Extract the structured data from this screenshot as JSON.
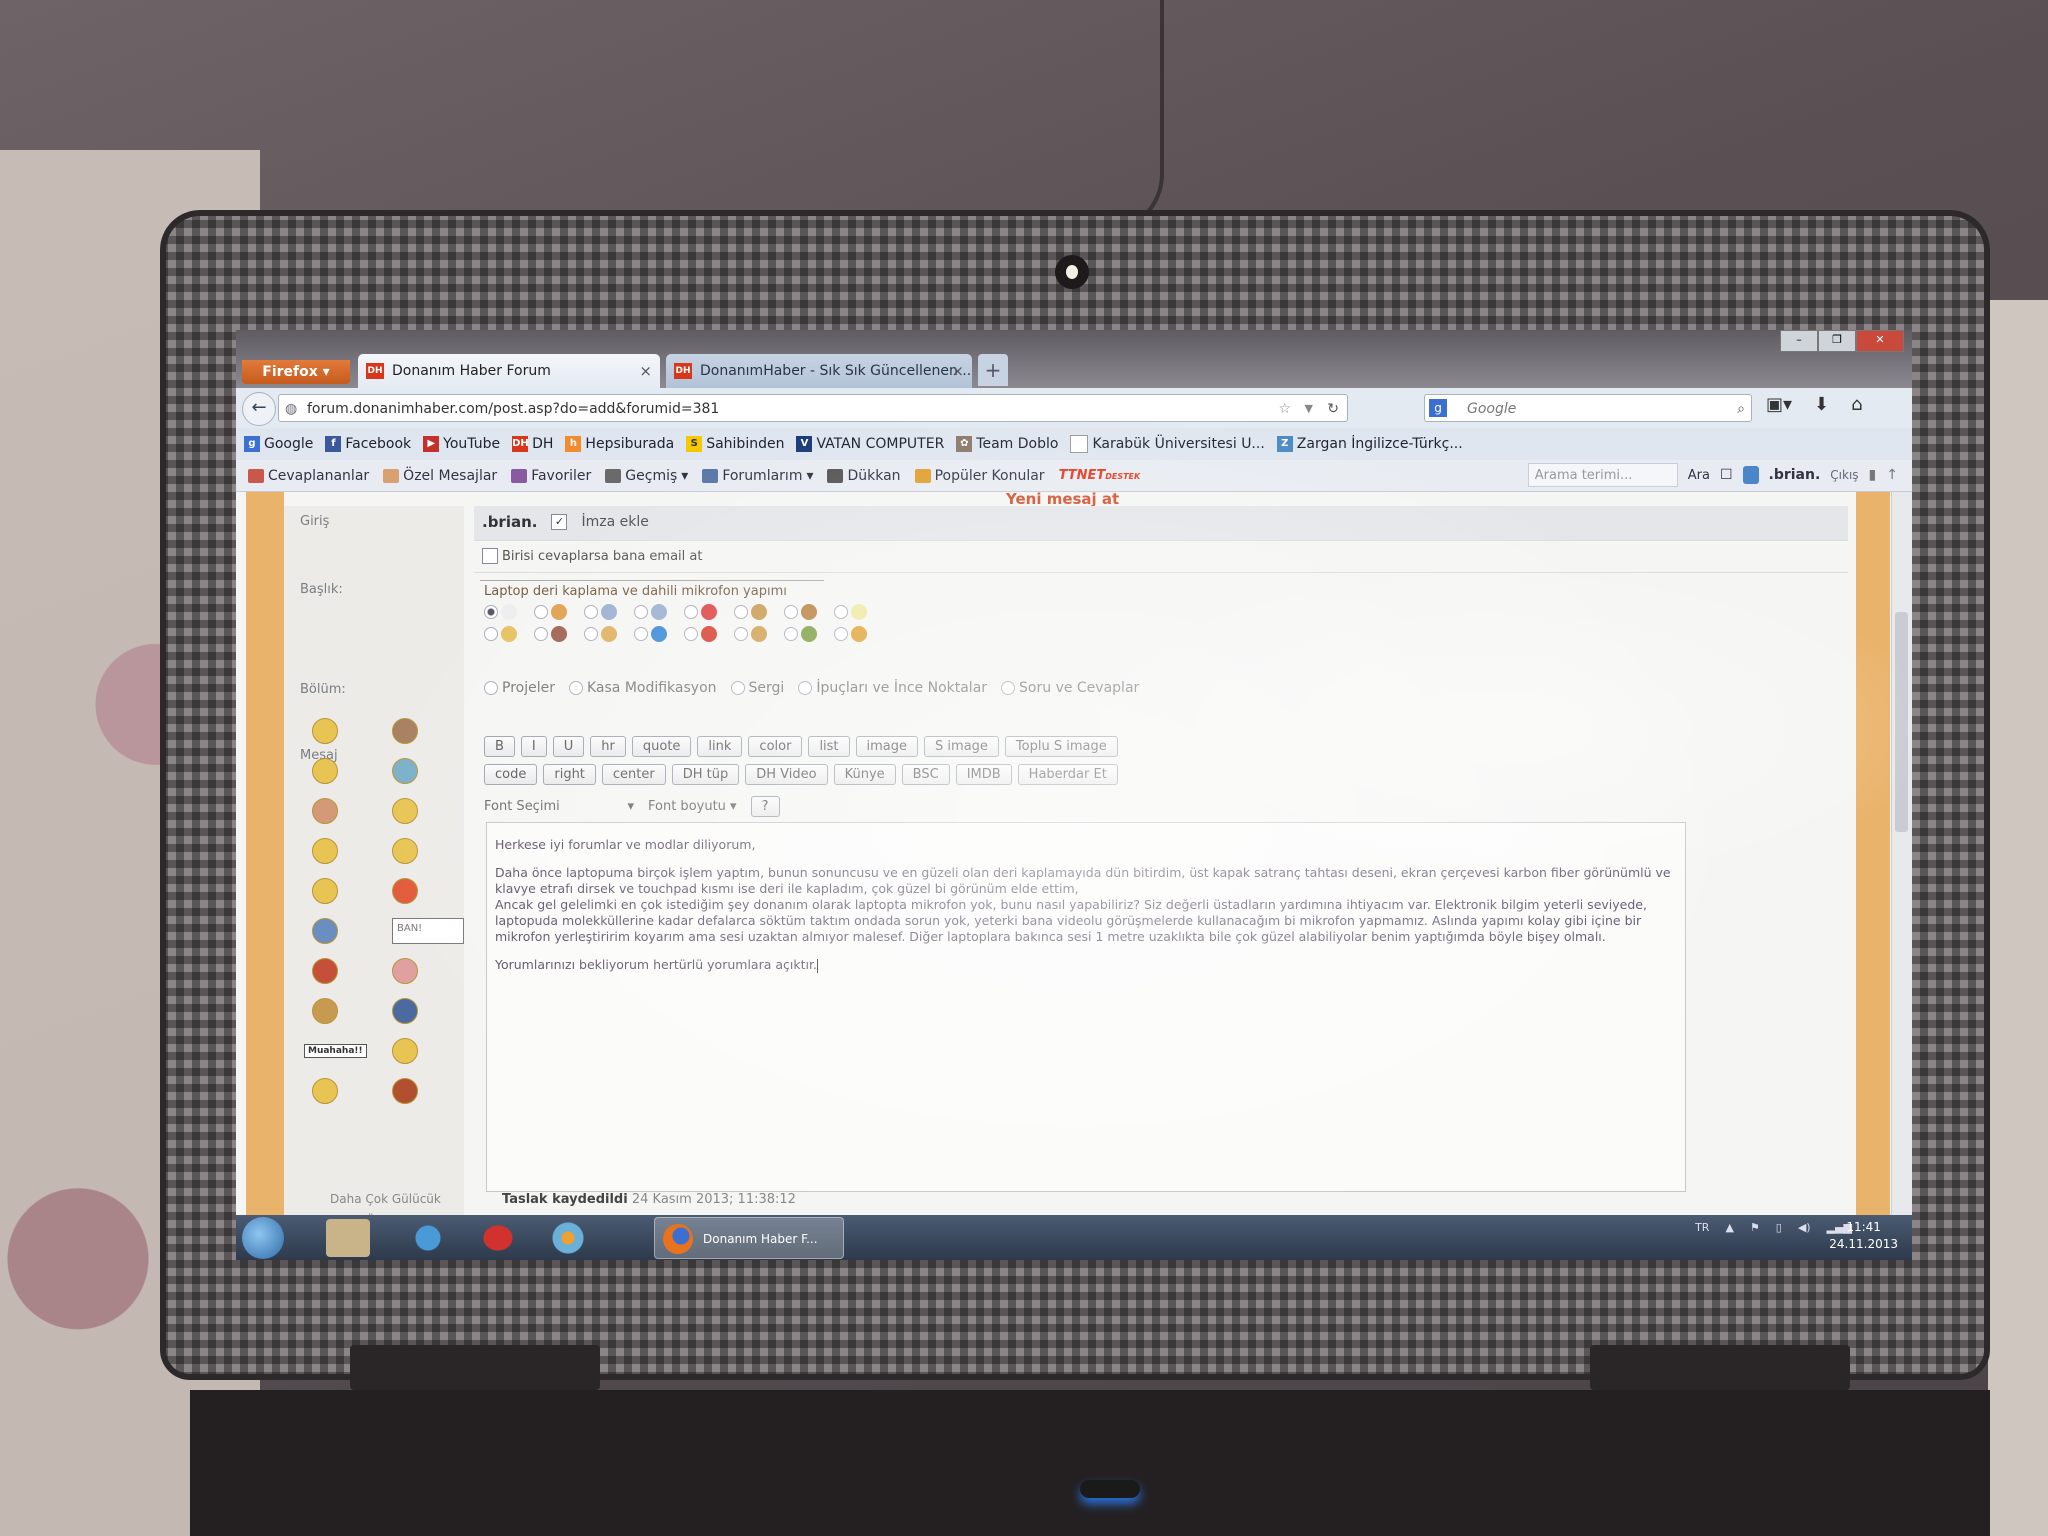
{
  "browser": {
    "menu_button": "Firefox",
    "tabs": [
      {
        "label": "Donanım Haber Forum",
        "favicon": "DH",
        "active": true
      },
      {
        "label": "DonanımHaber - Sık Sık Güncellenen ...",
        "favicon": "DH",
        "active": false
      }
    ],
    "new_tab": "+",
    "url": "forum.donanimhaber.com/post.asp?do=add&forumid=381",
    "search_engine": "Google",
    "search_placeholder": "Google"
  },
  "bookmarks": [
    {
      "label": "Google",
      "icon": "google-icon",
      "color": "#3b6fd1",
      "glyph": "g"
    },
    {
      "label": "Facebook",
      "icon": "facebook-icon",
      "color": "#3b5998",
      "glyph": "f"
    },
    {
      "label": "YouTube",
      "icon": "youtube-icon",
      "color": "#c4302b",
      "glyph": "▶"
    },
    {
      "label": "DH",
      "icon": "dh-icon",
      "color": "#d7381c",
      "glyph": "DH"
    },
    {
      "label": "Hepsiburada",
      "icon": "hepsiburada-icon",
      "color": "#f28a2f",
      "glyph": "h"
    },
    {
      "label": "Sahibinden",
      "icon": "sahibinden-icon",
      "color": "#f6c800",
      "glyph": "S"
    },
    {
      "label": "VATAN COMPUTER",
      "icon": "vatan-icon",
      "color": "#1c3d7a",
      "glyph": "V"
    },
    {
      "label": "Team Doblo",
      "icon": "teamdoblo-icon",
      "color": "#8a7a6a",
      "glyph": "✿"
    },
    {
      "label": "Karabük Üniversitesi U...",
      "icon": "page-icon",
      "color": "#ffffff",
      "glyph": ""
    },
    {
      "label": "Zargan İngilizce-Türkç...",
      "icon": "zargan-icon",
      "color": "#4a8ac4",
      "glyph": "Z"
    }
  ],
  "forum_toolbar": {
    "items": [
      {
        "label": "Cevaplananlar",
        "icon": "replies-icon"
      },
      {
        "label": "Özel Mesajlar",
        "icon": "envelope-icon"
      },
      {
        "label": "Favoriler",
        "icon": "heart-icon"
      },
      {
        "label": "Geçmiş",
        "icon": "history-icon",
        "dropdown": true
      },
      {
        "label": "Forumlarım",
        "icon": "forums-icon",
        "dropdown": true
      },
      {
        "label": "Dükkan",
        "icon": "cart-icon"
      },
      {
        "label": "Popüler Konular",
        "icon": "chart-icon"
      }
    ],
    "ttnet_logo": "TTNET",
    "ttnet_sub": "DESTEK",
    "search_placeholder": "Arama terimi...",
    "search_button": "Ara",
    "username": ".brian.",
    "logout": "Çıkış"
  },
  "post_form": {
    "heading": "Yeni mesaj at",
    "login_label": "Giriş",
    "username": ".brian.",
    "signature_label": "İmza ekle",
    "signature_checked": true,
    "email_notify_label": "Birisi cevaplarsa bana email at",
    "email_notify_checked": false,
    "title_label": "Başlık:",
    "title_value": "Laptop deri kaplama ve dahili mikrofon yapımı",
    "section_label": "Bölüm:",
    "sections": [
      "Projeler",
      "Kasa Modifikasyon",
      "Sergi",
      "İpuçları ve İnce Noktalar",
      "Soru ve Cevaplar"
    ],
    "message_label": "Mesaj",
    "format_buttons_row1": [
      "B",
      "I",
      "U",
      "hr",
      "quote",
      "link",
      "color",
      "list",
      "image",
      "S image",
      "Toplu S image"
    ],
    "format_buttons_row2": [
      "code",
      "right",
      "center",
      "DH tüp",
      "DH Video",
      "Künye",
      "BSC",
      "IMDB",
      "Haberdar Et"
    ],
    "font_select": "Font Seçimi",
    "font_size_select": "Font boyutu",
    "help_button": "?",
    "message_paragraphs": [
      "Herkese iyi forumlar ve modlar diliyorum,",
      "Daha önce laptopuma birçok işlem yaptım, bunun sonuncusu ve en güzeli olan deri kaplamayıda dün bitirdim, üst kapak satranç tahtası deseni, ekran çerçevesi karbon fiber görünümlü ve klavye etrafı dirsek ve touchpad kısmı ise deri ile kapladım, çok güzel bi görünüm elde ettim,\nAncak gel gelelimki en çok istediğim şey donanım olarak laptopta mikrofon yok, bunu nasıl yapabiliriz? Siz değerli üstadların yardımına ihtiyacım var. Elektronik bilgim yeterli seviyede, laptopuda molekküllerine kadar defalarca söktüm taktım ondada sorun yok, yeterki bana videolu görüşmelerde kullanacağım bi mikrofon yapmamız. Aslında yapımı kolay gibi içine bir mikrofon yerleştiririm koyarım ama sesi uzaktan almıyor malesef. Diğer laptoplara bakınca sesi 1 metre uzaklıkta bile çok güzel alabiliyolar benim yaptığımda böyle bişey olmalı.",
      "Yorumlarınızı bekliyorum hertürlü yorumlara açıktır."
    ],
    "more_smileys": "Daha Çok Gülücük",
    "customize": "Özelleştir",
    "draft_label": "Taslak kaydedildi",
    "draft_time": "24 Kasım 2013; 11:38:12",
    "smiley_signs": {
      "ban": "BAN!",
      "muahaha": "Muahaha!!"
    }
  },
  "taskbar": {
    "active_window": "Donanım Haber F...",
    "language": "TR",
    "time": "11:41",
    "date": "24.11.2013"
  }
}
